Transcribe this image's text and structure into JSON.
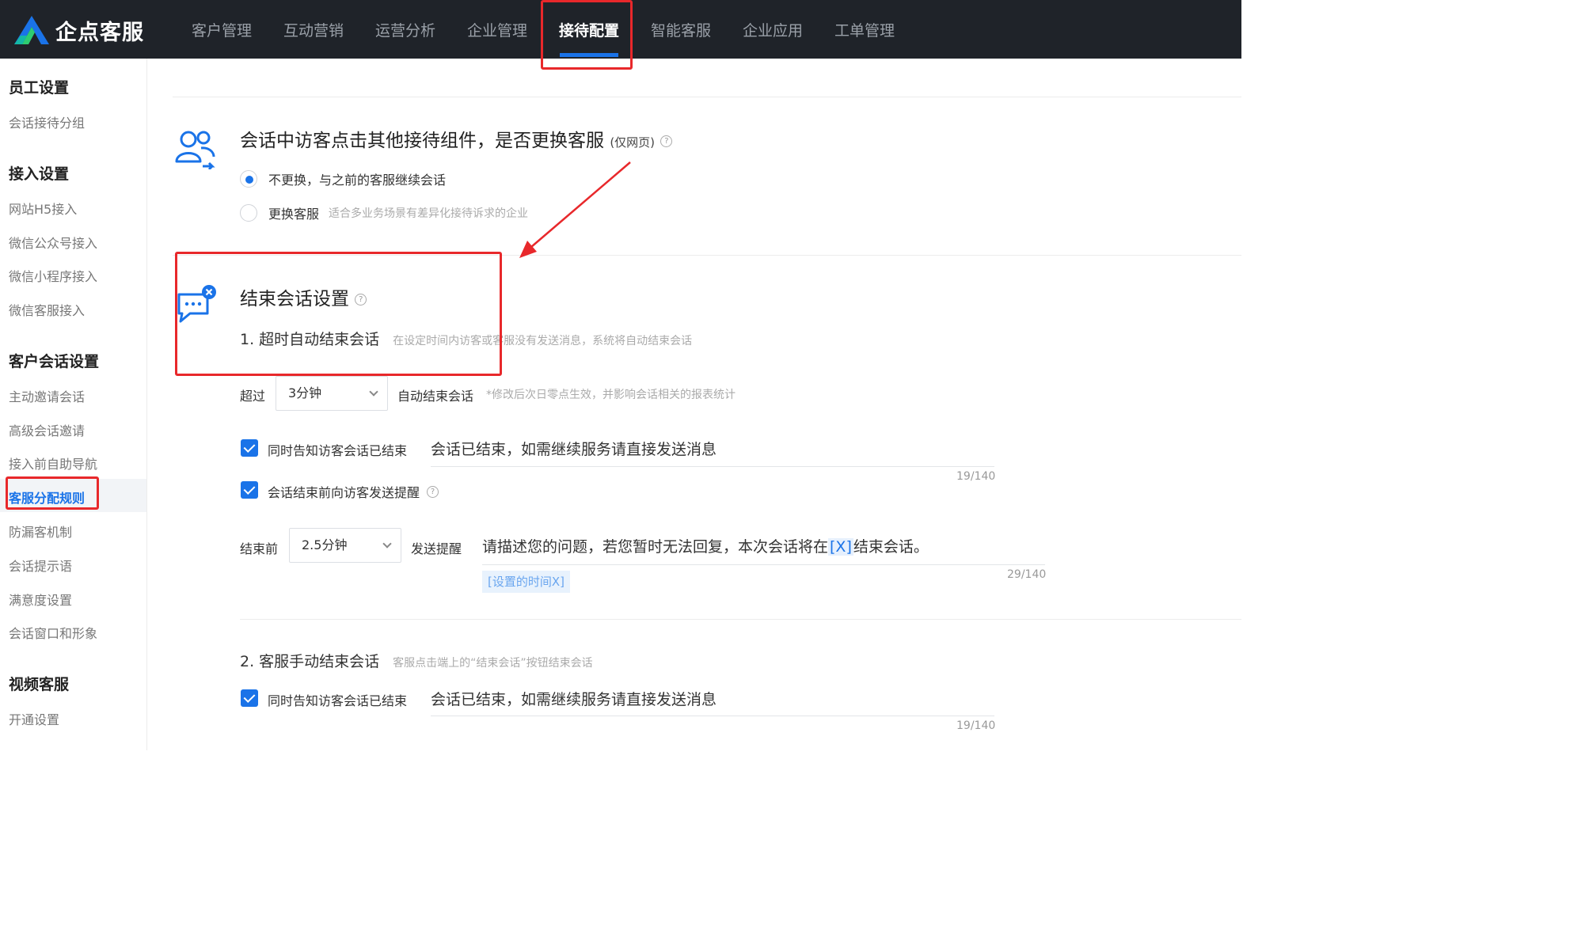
{
  "brand": {
    "name": "企点客服",
    "colors": {
      "accent": "#1a73e8",
      "nav_bg": "#1f2329",
      "annotation": "#e8282b"
    }
  },
  "nav": {
    "items": [
      {
        "label": "客户管理"
      },
      {
        "label": "互动营销"
      },
      {
        "label": "运营分析"
      },
      {
        "label": "企业管理"
      },
      {
        "label": "接待配置",
        "active": true
      },
      {
        "label": "智能客服"
      },
      {
        "label": "企业应用"
      },
      {
        "label": "工单管理"
      }
    ]
  },
  "sidebar": {
    "sections": [
      {
        "title": "员工设置",
        "items": [
          "会话接待分组"
        ]
      },
      {
        "title": "接入设置",
        "items": [
          "网站H5接入",
          "微信公众号接入",
          "微信小程序接入",
          "微信客服接入"
        ]
      },
      {
        "title": "客户会话设置",
        "items": [
          "主动邀请会话",
          "高级会话邀请",
          "接入前自助导航",
          "客服分配规则",
          "防漏客机制",
          "会话提示语",
          "满意度设置",
          "会话窗口和形象"
        ]
      },
      {
        "title": "视频客服",
        "items": [
          "开通设置"
        ]
      }
    ],
    "active_item": "客服分配规则"
  },
  "switch_section": {
    "title": "会话中访客点击其他接待组件，是否更换客服",
    "title_suffix": "(仅网页)",
    "icon": "users-switch-icon",
    "options": [
      {
        "label": "不更换，与之前的客服继续会话",
        "hint": "",
        "checked": true
      },
      {
        "label": "更换客服",
        "hint": "适合多业务场景有差异化接待诉求的企业",
        "checked": false
      }
    ]
  },
  "end_section": {
    "title": "结束会话设置",
    "icon": "chat-close-icon",
    "auto": {
      "heading": "1. 超时自动结束会话",
      "hint": "在设定时间内访客或客服没有发送消息，系统将自动结束会话",
      "prefix": "超过",
      "timeout": "3分钟",
      "suffix": "自动结束会话",
      "note": "*修改后次日零点生效，并影响会话相关的报表统计",
      "notify_label": "同时告知访客会话已结束",
      "notify_checked": true,
      "notify_message": "会话已结束，如需继续服务请直接发送消息",
      "notify_counter": "19/140",
      "remind_label": "会话结束前向访客发送提醒",
      "remind_checked": true,
      "remind_prefix": "结束前",
      "remind_time": "2.5分钟",
      "remind_suffix": "发送提醒",
      "remind_message_before": "请描述您的问题，若您暂时无法回复，本次会话将在",
      "remind_message_var": "[X]",
      "remind_message_after": "结束会话。",
      "remind_counter": "29/140",
      "var_tag": "[设置的时间X]"
    },
    "manual": {
      "heading": "2. 客服手动结束会话",
      "hint": "客服点击端上的“结束会话”按钮结束会话",
      "notify_label": "同时告知访客会话已结束",
      "notify_checked": true,
      "notify_message": "会话已结束，如需继续服务请直接发送消息",
      "notify_counter": "19/140"
    }
  }
}
